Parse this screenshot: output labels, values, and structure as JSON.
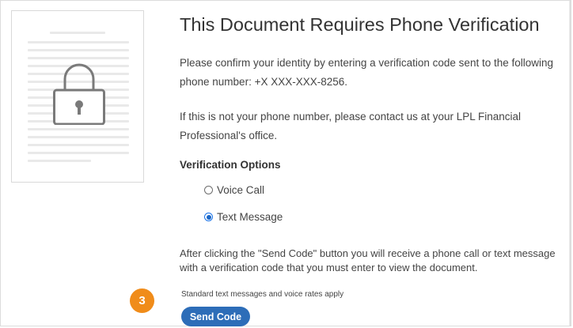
{
  "title": "This Document Requires Phone Verification",
  "intro": "Please confirm your identity by entering a verification code sent to the following phone number: +X XXX-XXX-8256.",
  "not_your_number": "If this is not your phone number, please contact us at your LPL Financial Professional's office.",
  "verification_options": {
    "heading": "Verification Options",
    "options": [
      {
        "label": "Voice Call",
        "selected": false
      },
      {
        "label": "Text Message",
        "selected": true
      }
    ]
  },
  "instructions": "After clicking the \"Send Code\" button you will receive a phone call or text message with a verification code that you must enter to view the document.",
  "rates_note": "Standard text messages and voice rates apply",
  "step_badge": "3",
  "send_button_label": "Send Code",
  "colors": {
    "accent": "#2d6db8",
    "badge": "#f08c1a"
  },
  "icons": {
    "thumbnail_lock": "lock-icon"
  }
}
